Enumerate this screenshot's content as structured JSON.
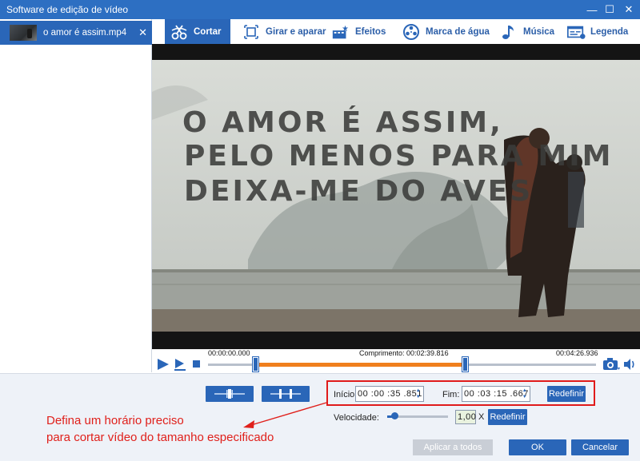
{
  "window": {
    "title": "Software de edição de vídeo",
    "min_symbol": "—",
    "max_symbol": "☐",
    "close_symbol": "✕"
  },
  "file_list": {
    "items": [
      {
        "name": "o amor é assim.mp4",
        "close_symbol": "✕"
      }
    ]
  },
  "tabs": [
    {
      "label": "Cortar",
      "icon": "scissors-icon",
      "active": true
    },
    {
      "label": "Girar e aparar",
      "icon": "crop-icon",
      "active": false
    },
    {
      "label": "Efeitos",
      "icon": "effects-icon",
      "active": false
    },
    {
      "label": "Marca de água",
      "icon": "watermark-icon",
      "active": false
    },
    {
      "label": "Música",
      "icon": "music-note-icon",
      "active": false
    },
    {
      "label": "Legenda",
      "icon": "subtitle-icon",
      "active": false
    }
  ],
  "video": {
    "lines": [
      "O AMOR É ASSIM,",
      "PELO MENOS PARA MIM",
      "DEIXA-ME DO AVES"
    ]
  },
  "timeline": {
    "start_time": "00:00:00.000",
    "length_label": "Comprimento: 00:02:39.816",
    "end_time": "00:04:26.936",
    "trim_start_fraction": 0.123,
    "trim_end_fraction": 0.664
  },
  "trim": {
    "start_label": "Início:",
    "start_value": "00 :00 :35 .851",
    "end_label": "Fim:",
    "end_value": "00 :03 :15 .667",
    "reset_label": "Redefinir"
  },
  "speed": {
    "label": "Velocidade:",
    "value": "1,00",
    "unit": "X",
    "reset_label": "Redefinir",
    "slider_fraction": 0.12
  },
  "annotation": {
    "line1": "Defina um horário preciso",
    "line2": "para cortar vídeo do tamanho especificado"
  },
  "buttons": {
    "apply_all": "Aplicar a todos",
    "ok": "OK",
    "cancel": "Cancelar"
  },
  "colors": {
    "accent": "#2a66b8",
    "titlebar": "#2d6fc2",
    "trim_range": "#f07f1d",
    "annotation": "#e0201b"
  }
}
